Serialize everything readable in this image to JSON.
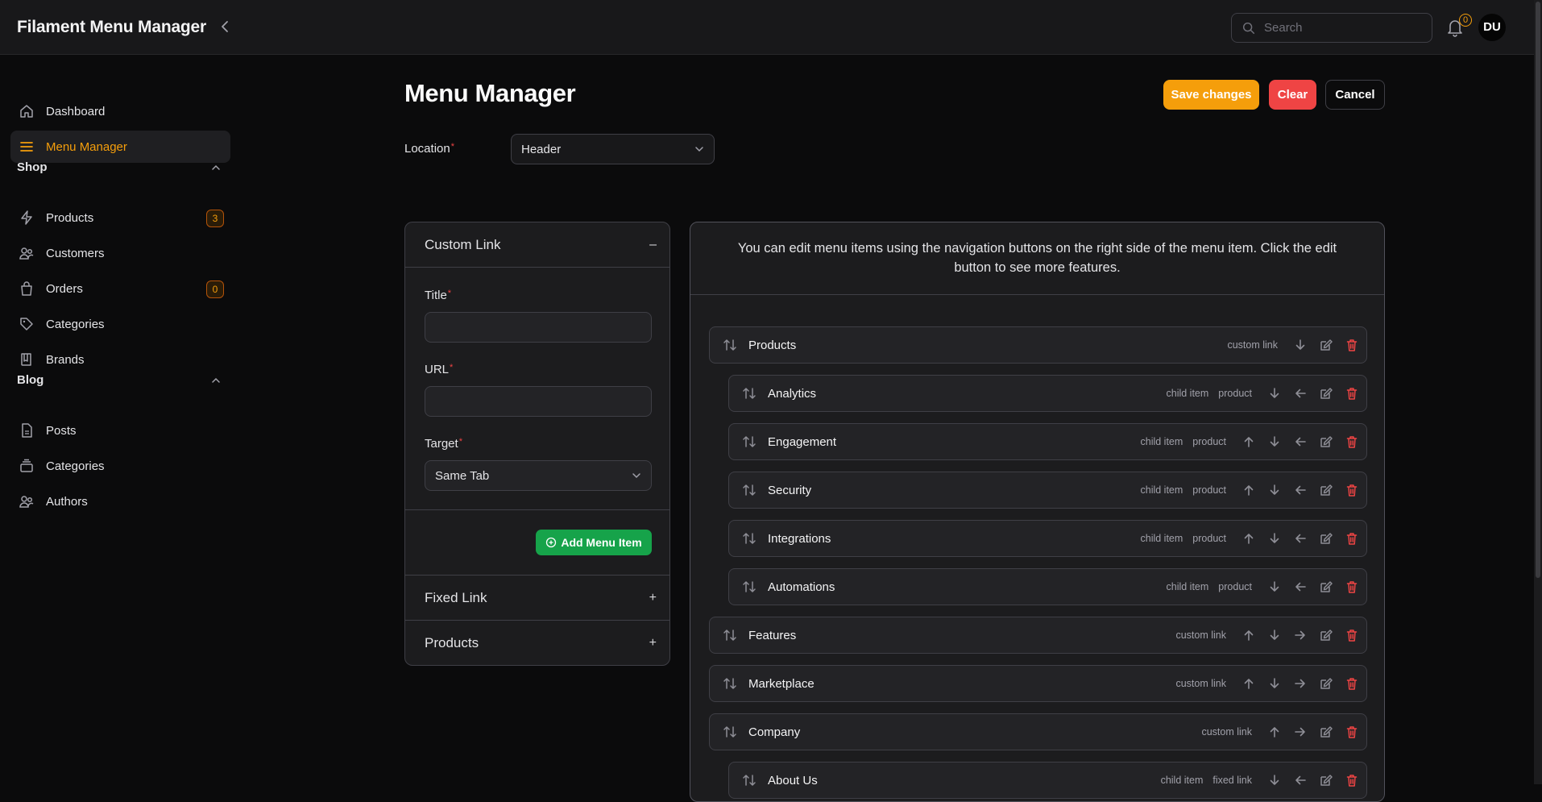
{
  "app": {
    "brand": "Filament Menu Manager"
  },
  "topbar": {
    "search_placeholder": "Search",
    "notifications_count": "0",
    "avatar_initials": "DU"
  },
  "sidebar": {
    "top_items": [
      {
        "label": "Dashboard",
        "icon": "home-icon"
      },
      {
        "label": "Menu Manager",
        "icon": "menu-bars-icon",
        "active": true
      }
    ],
    "groups": [
      {
        "label": "Shop",
        "items": [
          {
            "label": "Products",
            "icon": "bolt-icon",
            "badge": "3"
          },
          {
            "label": "Customers",
            "icon": "users-icon"
          },
          {
            "label": "Orders",
            "icon": "shopping-bag-icon",
            "badge": "0"
          },
          {
            "label": "Categories",
            "icon": "tag-icon"
          },
          {
            "label": "Brands",
            "icon": "book-icon"
          }
        ]
      },
      {
        "label": "Blog",
        "items": [
          {
            "label": "Posts",
            "icon": "document-icon"
          },
          {
            "label": "Categories",
            "icon": "stack-icon"
          },
          {
            "label": "Authors",
            "icon": "users-icon"
          }
        ]
      }
    ]
  },
  "header": {
    "title": "Menu Manager",
    "save_label": "Save changes",
    "clear_label": "Clear",
    "cancel_label": "Cancel"
  },
  "location": {
    "label": "Location",
    "value": "Header"
  },
  "builder": {
    "custom_link": {
      "title": "Custom Link",
      "toggle": "–",
      "title_label": "Title",
      "title_value": "",
      "url_label": "URL",
      "url_value": "",
      "target_label": "Target",
      "target_value": "Same Tab",
      "add_label": "Add Menu Item"
    },
    "fixed_link": {
      "title": "Fixed Link",
      "toggle": "+"
    },
    "products": {
      "title": "Products",
      "toggle": "+"
    }
  },
  "menu": {
    "info": "You can edit menu items using the navigation buttons on the right side of the menu item. Click the edit button to see more features.",
    "items": [
      {
        "label": "Products",
        "tags": [
          "custom link"
        ],
        "depth": 0,
        "actions": [
          "down",
          "edit",
          "delete"
        ]
      },
      {
        "label": "Analytics",
        "tags": [
          "child item",
          "product"
        ],
        "depth": 1,
        "actions": [
          "down",
          "left",
          "edit",
          "delete"
        ]
      },
      {
        "label": "Engagement",
        "tags": [
          "child item",
          "product"
        ],
        "depth": 1,
        "actions": [
          "up",
          "down",
          "left",
          "edit",
          "delete"
        ]
      },
      {
        "label": "Security",
        "tags": [
          "child item",
          "product"
        ],
        "depth": 1,
        "actions": [
          "up",
          "down",
          "left",
          "edit",
          "delete"
        ]
      },
      {
        "label": "Integrations",
        "tags": [
          "child item",
          "product"
        ],
        "depth": 1,
        "actions": [
          "up",
          "down",
          "left",
          "edit",
          "delete"
        ]
      },
      {
        "label": "Automations",
        "tags": [
          "child item",
          "product"
        ],
        "depth": 1,
        "actions": [
          "down",
          "left",
          "edit",
          "delete"
        ]
      },
      {
        "label": "Features",
        "tags": [
          "custom link"
        ],
        "depth": 0,
        "actions": [
          "up",
          "down",
          "right",
          "edit",
          "delete"
        ]
      },
      {
        "label": "Marketplace",
        "tags": [
          "custom link"
        ],
        "depth": 0,
        "actions": [
          "up",
          "down",
          "right",
          "edit",
          "delete"
        ]
      },
      {
        "label": "Company",
        "tags": [
          "custom link"
        ],
        "depth": 0,
        "actions": [
          "up",
          "right",
          "edit",
          "delete"
        ]
      },
      {
        "label": "About Us",
        "tags": [
          "child item",
          "fixed link"
        ],
        "depth": 1,
        "actions": [
          "down",
          "left",
          "edit",
          "delete"
        ]
      }
    ]
  },
  "colors": {
    "accent": "#f59e0b",
    "danger": "#ef4444",
    "success": "#16a34a",
    "background": "#0b0b0c",
    "surface": "#1c1c1e"
  }
}
